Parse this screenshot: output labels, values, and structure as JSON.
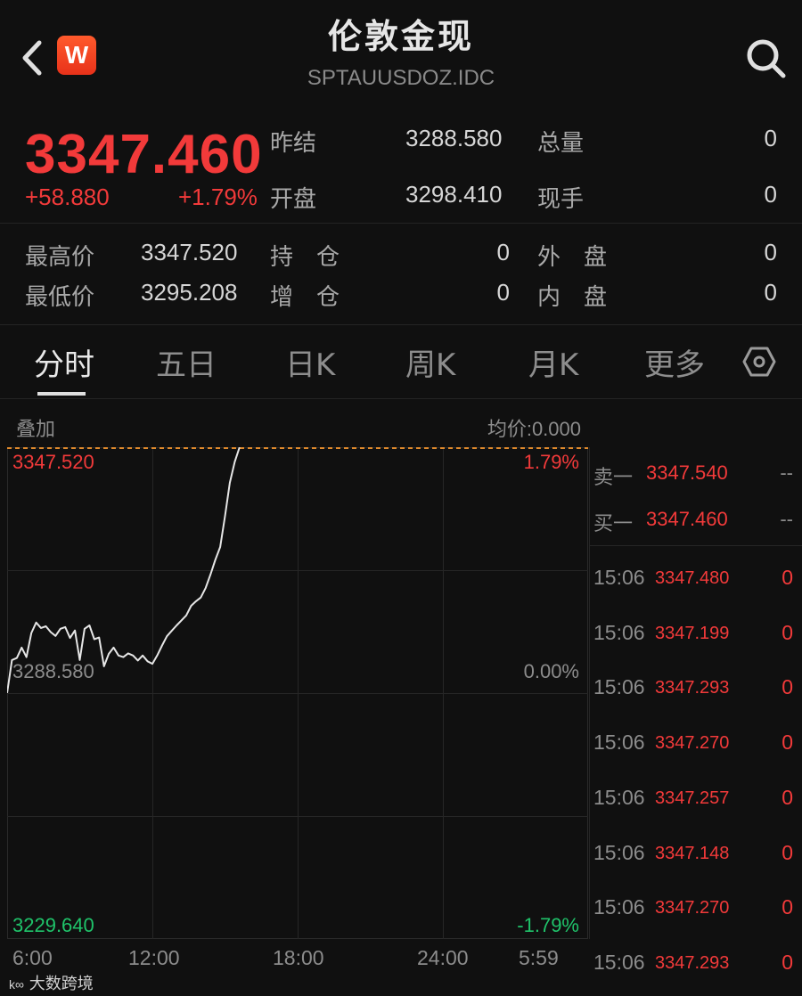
{
  "header": {
    "title": "伦敦金现",
    "symbol": "SPTAUUSDOZ.IDC",
    "logo_letter": "W"
  },
  "quote": {
    "price": "3347.460",
    "change": "+58.880",
    "change_pct": "+1.79%",
    "prev_close_label": "昨结",
    "prev_close": "3288.580",
    "open_label": "开盘",
    "open": "3298.410",
    "volume_label": "总量",
    "volume": "0",
    "current_hand_label": "现手",
    "current_hand": "0",
    "high_label": "最高价",
    "high": "3347.520",
    "low_label": "最低价",
    "low": "3295.208",
    "position_label": "持　仓",
    "position": "0",
    "increase_label": "增　仓",
    "increase": "0",
    "outer_label": "外　盘",
    "outer": "0",
    "inner_label": "内　盘",
    "inner": "0"
  },
  "tabs": [
    "分时",
    "五日",
    "日K",
    "周K",
    "月K",
    "更多"
  ],
  "chart_header": {
    "overlay_label": "叠加",
    "avg_price_label": "均价:0.000"
  },
  "chart_data": {
    "type": "line",
    "y_labels": {
      "top": "3347.520",
      "mid": "3288.580",
      "bottom": "3229.640"
    },
    "pct_labels": {
      "top": "1.79%",
      "mid": "0.00%",
      "bottom": "-1.79%"
    },
    "x_ticks": [
      "6:00",
      "12:00",
      "18:00",
      "24:00",
      "5:59"
    ],
    "ylim": [
      3229.64,
      3347.52
    ],
    "x_points": [
      0.0,
      0.2,
      0.4,
      0.6,
      0.8,
      1.0,
      1.2,
      1.4,
      1.6,
      1.8,
      2.0,
      2.2,
      2.4,
      2.6,
      2.8,
      3.0,
      3.2,
      3.4,
      3.6,
      3.8,
      4.0,
      4.2,
      4.4,
      4.6,
      4.8,
      5.0,
      5.2,
      5.4,
      5.6,
      5.8,
      6.0,
      6.2,
      6.4,
      6.6,
      6.8,
      7.0,
      7.2,
      7.4,
      7.6,
      7.8,
      8.0,
      8.2,
      8.4,
      8.6,
      8.8,
      9.0,
      9.2,
      9.4,
      9.6
    ],
    "values": [
      3288.6,
      3296.5,
      3297.0,
      3299.5,
      3297.2,
      3303.0,
      3305.5,
      3304.2,
      3304.6,
      3303.2,
      3302.3,
      3304.0,
      3304.4,
      3301.8,
      3303.6,
      3296.5,
      3304.0,
      3304.8,
      3301.5,
      3301.9,
      3295.0,
      3298.0,
      3299.5,
      3297.6,
      3297.2,
      3298.1,
      3297.6,
      3296.4,
      3297.6,
      3296.2,
      3295.6,
      3297.6,
      3300.0,
      3302.2,
      3303.5,
      3304.8,
      3306.0,
      3307.2,
      3309.5,
      3310.6,
      3311.5,
      3313.8,
      3317.0,
      3320.5,
      3323.6,
      3331.0,
      3339.0,
      3344.0,
      3347.5
    ],
    "series": [
      {
        "name": "",
        "color": "#e6e6e6"
      }
    ]
  },
  "order_book": {
    "ask_label": "卖一",
    "ask_price": "3347.540",
    "ask_qty": "--",
    "bid_label": "买一",
    "bid_price": "3347.460",
    "bid_qty": "--"
  },
  "ticks": [
    {
      "time": "15:06",
      "price": "3347.480",
      "qty": "0"
    },
    {
      "time": "15:06",
      "price": "3347.199",
      "qty": "0"
    },
    {
      "time": "15:06",
      "price": "3347.293",
      "qty": "0"
    },
    {
      "time": "15:06",
      "price": "3347.270",
      "qty": "0"
    },
    {
      "time": "15:06",
      "price": "3347.257",
      "qty": "0"
    },
    {
      "time": "15:06",
      "price": "3347.148",
      "qty": "0"
    },
    {
      "time": "15:06",
      "price": "3347.270",
      "qty": "0"
    },
    {
      "time": "15:06",
      "price": "3347.293",
      "qty": "0"
    }
  ],
  "watermark": "大数跨境",
  "colors": {
    "up": "#f23a3a",
    "down": "#1fc36a",
    "background": "#101010"
  }
}
